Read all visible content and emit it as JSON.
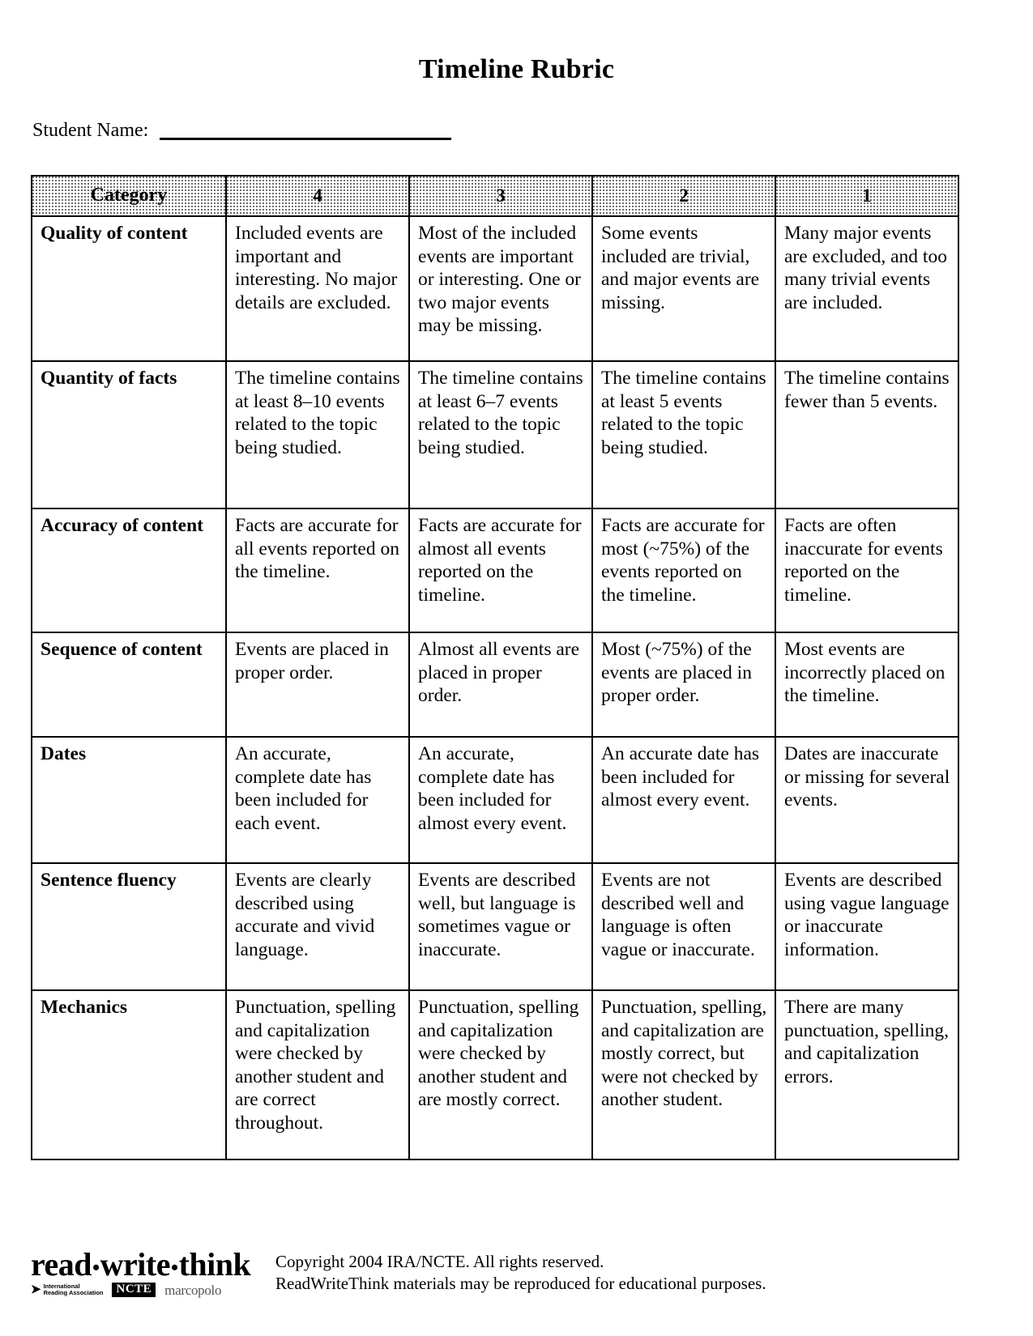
{
  "document": {
    "title": "Timeline Rubric",
    "student_name_label": "Student Name:",
    "student_name_value": ""
  },
  "table": {
    "headers": [
      "Category",
      "4",
      "3",
      "2",
      "1"
    ],
    "rows": [
      {
        "category": "Quality of content",
        "level4": "Included events are important and interesting. No major details are excluded.",
        "level3": "Most of the included events are important or interesting. One or two major events may be missing.",
        "level2": "Some events included are trivial, and major events are missing.",
        "level1": "Many major events are excluded, and too many trivial events are included."
      },
      {
        "category": "Quantity of facts",
        "level4": "The timeline contains at least 8–10 events related to the topic being studied.",
        "level3": "The timeline contains at least 6–7 events related to the topic being studied.",
        "level2": "The timeline contains at least 5 events related to the topic being studied.",
        "level1": "The timeline contains fewer than 5 events."
      },
      {
        "category": "Accuracy of content",
        "level4": "Facts are accurate for all events reported on the timeline.",
        "level3": "Facts are accurate for almost all events reported on the timeline.",
        "level2": "Facts are accurate for most (~75%) of the events reported on the timeline.",
        "level1": "Facts are often inaccurate for events reported on the timeline."
      },
      {
        "category": "Sequence of content",
        "level4": "Events are placed in proper order.",
        "level3": "Almost all events are placed in proper order.",
        "level2": "Most (~75%) of the events are placed in proper order.",
        "level1": "Most events are incorrectly placed on the timeline."
      },
      {
        "category": "Dates",
        "level4": "An accurate, complete date has been included for each event.",
        "level3": "An accurate, complete date has been included for almost every event.",
        "level2": "An accurate date has been included for almost every event.",
        "level1": "Dates are inaccurate or missing for several events."
      },
      {
        "category": "Sentence fluency",
        "level4": "Events are clearly described using accurate and vivid language.",
        "level3": "Events are described well, but language is sometimes vague or inaccurate.",
        "level2": "Events are not described well and language is often vague or inaccurate.",
        "level1": "Events are described using vague language or inaccurate information."
      },
      {
        "category": "Mechanics",
        "level4": "Punctuation, spelling and capitalization were checked by another student and are correct throughout.",
        "level3": "Punctuation, spelling and capitalization were checked by another student and are mostly correct.",
        "level2": "Punctuation, spelling, and capitalization are mostly correct, but were not checked by another student.",
        "level1": "There are many punctuation, spelling, and capitalization errors."
      }
    ]
  },
  "footer": {
    "logo": {
      "word1": "read",
      "sep1": "•",
      "word2": "write",
      "sep2": "•",
      "word3": "think",
      "ira_mark": "➤",
      "ira_line1": "International",
      "ira_line2": "Reading Association",
      "ncte": "NCTE",
      "marcopolo": "marcopolo"
    },
    "copyright_line1": "Copyright 2004 IRA/NCTE. All rights reserved.",
    "copyright_line2": "ReadWriteThink materials may be reproduced for educational purposes."
  }
}
